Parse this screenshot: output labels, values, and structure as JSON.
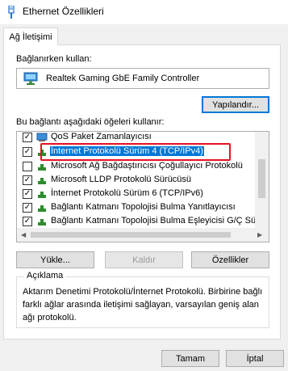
{
  "window": {
    "title": "Ethernet Özellikleri"
  },
  "tabs": [
    {
      "label": "Ağ İletişimi"
    }
  ],
  "connect_using": {
    "label": "Bağlanırken kullan:",
    "adapter_name": "Realtek Gaming GbE Family Controller",
    "configure_label": "Yapılandır..."
  },
  "items_section": {
    "label": "Bu bağlantı aşağıdaki öğeleri kullanır:",
    "items": [
      {
        "label": "QoS Paket Zamanlayıcısı",
        "checked": true,
        "icon": "qos-icon"
      },
      {
        "label": "İnternet Protokolü Sürüm 4 (TCP/IPv4)",
        "checked": true,
        "icon": "protocol-icon",
        "selected": true
      },
      {
        "label": "Microsoft Ağ Bağdaştırıcısı Çoğullayıcı Protokolü",
        "checked": false,
        "icon": "protocol-icon"
      },
      {
        "label": "Microsoft LLDP Protokolü Sürücüsü",
        "checked": true,
        "icon": "protocol-icon"
      },
      {
        "label": "İnternet Protokolü Sürüm 6 (TCP/IPv6)",
        "checked": true,
        "icon": "protocol-icon"
      },
      {
        "label": "Bağlantı Katmanı Topolojisi Bulma Yanıtlayıcısı",
        "checked": true,
        "icon": "protocol-icon"
      },
      {
        "label": "Bağlantı Katmanı Topolojisi Bulma Eşleyicisi G/Ç Sürücü",
        "checked": true,
        "icon": "protocol-icon"
      }
    ]
  },
  "actions": {
    "install": "Yükle...",
    "uninstall": "Kaldır",
    "properties": "Özellikler"
  },
  "description": {
    "title": "Açıklama",
    "text": "Aktarım Denetimi Protokolü/İnternet Protokolü. Birbirine bağlı farklı ağlar arasında iletişimi sağlayan, varsayılan geniş alan ağı protokolü."
  },
  "footer": {
    "ok": "Tamam",
    "cancel": "İptal"
  },
  "colors": {
    "highlight": "#e81123",
    "selection": "#0078d7"
  }
}
